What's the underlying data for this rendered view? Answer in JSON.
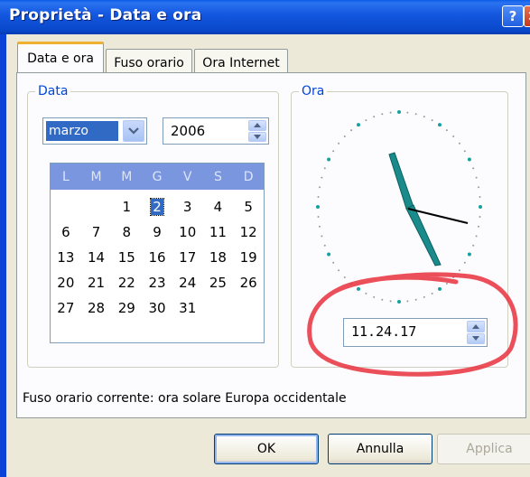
{
  "window": {
    "title": "Proprietà - Data e ora",
    "help_button": "?",
    "close_button": "x"
  },
  "tabs": [
    {
      "label": "Data e ora",
      "active": true
    },
    {
      "label": "Fuso orario",
      "active": false
    },
    {
      "label": "Ora Internet",
      "active": false
    }
  ],
  "date_group": {
    "label": "Data",
    "month": "marzo",
    "year": "2006",
    "weekday_headers": [
      "L",
      "M",
      "M",
      "G",
      "V",
      "S",
      "D"
    ],
    "selected_day": "2",
    "weeks": [
      [
        "",
        "",
        "",
        "1",
        "2",
        "3",
        "4",
        "5"
      ],
      [
        "6",
        "7",
        "8",
        "9",
        "10",
        "11",
        "12"
      ],
      [
        "13",
        "14",
        "15",
        "16",
        "17",
        "18",
        "19"
      ],
      [
        "20",
        "21",
        "22",
        "23",
        "24",
        "25",
        "26"
      ],
      [
        "27",
        "28",
        "29",
        "30",
        "31",
        "",
        ""
      ]
    ]
  },
  "time_group": {
    "label": "Ora",
    "time": "11.24.17"
  },
  "timezone_text": "Fuso orario corrente:  ora solare Europa occidentale",
  "buttons": {
    "ok": "OK",
    "cancel": "Annulla",
    "apply": "Applica"
  },
  "colors": {
    "title_bar": "#0a5ee8",
    "selection": "#316ac5",
    "clock_hands": "#1a8a8a",
    "annotation": "#e8303c"
  },
  "icons": {
    "month_dropdown": "chevron-down-icon",
    "spin_up": "triangle-up-icon",
    "spin_down": "triangle-down-icon"
  }
}
